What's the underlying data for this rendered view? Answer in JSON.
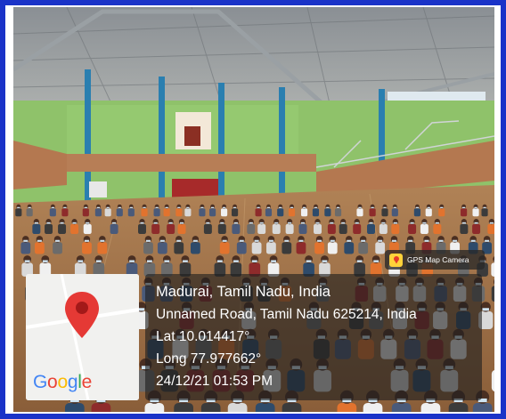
{
  "badge": {
    "label": "GPS Map Camera"
  },
  "map": {
    "logo": "Google"
  },
  "location": {
    "title": "Madurai, Tamil Nadu, India",
    "address": "Unnamed Road, Tamil Nadu 625214, India",
    "lat": "Lat 10.014417°",
    "long": "Long 77.977662°",
    "datetime": "24/12/21 01:53 PM"
  },
  "colors": {
    "border": "#1a33c8",
    "pin": "#e53935",
    "badge_icon": "#ffd23a"
  }
}
